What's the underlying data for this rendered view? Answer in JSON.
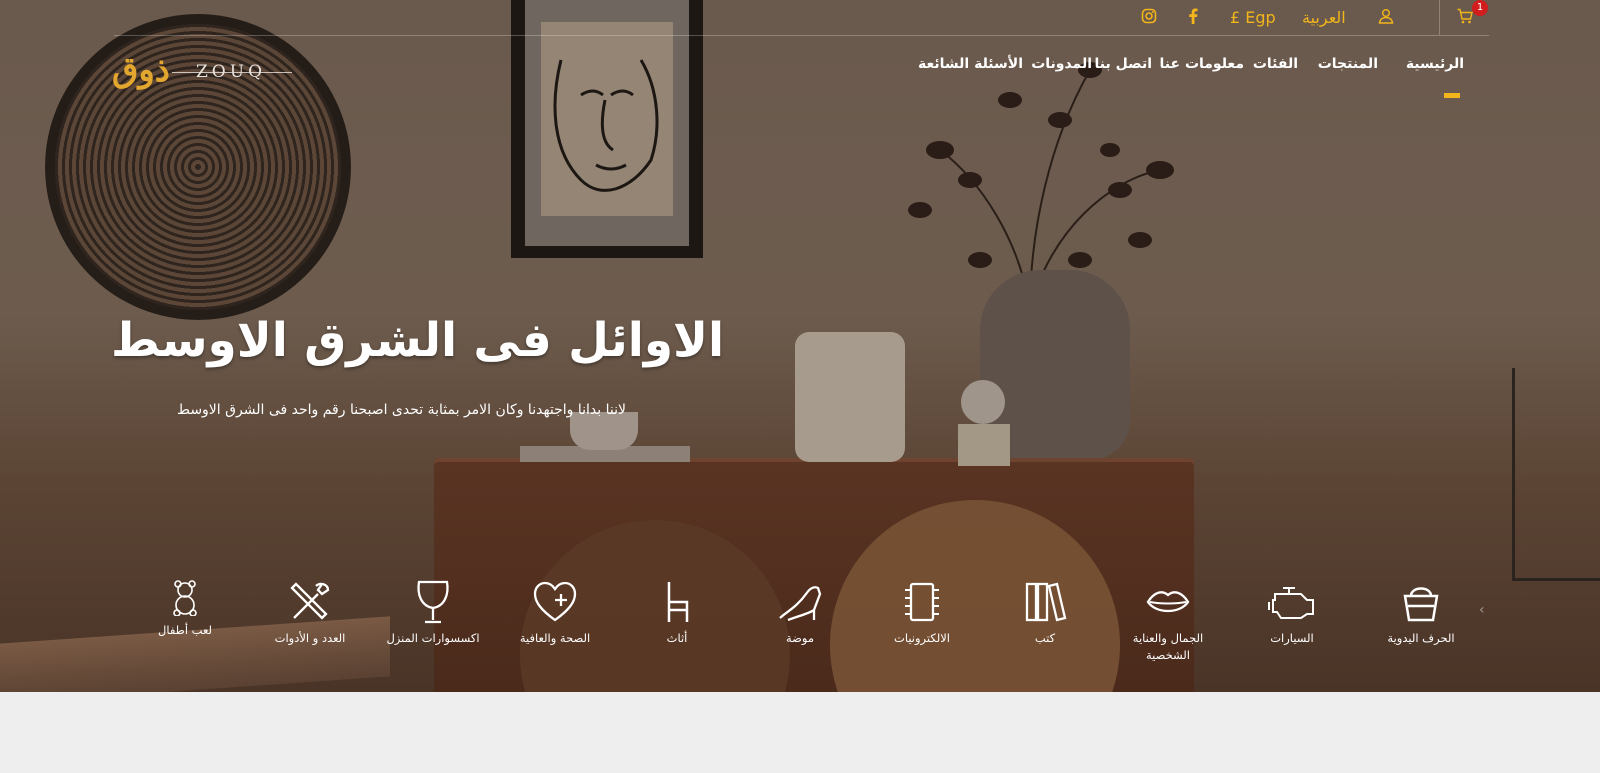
{
  "topbar": {
    "cart_count": "1",
    "language": "العربية",
    "currency": "£ Egp"
  },
  "logo": {
    "arabic": "ذوق",
    "latin": "ZOUQ"
  },
  "nav": {
    "items": [
      "الرئيسية",
      "المنتجات",
      "الفئات",
      "معلومات عنا",
      "اتصل بنا",
      "المدونات",
      "الأسئلة الشائعة"
    ],
    "active_index": 0
  },
  "hero": {
    "headline": "الاوائل فى الشرق الاوسط",
    "subline": "لاننا بدانا واجتهدنا وكان الامر بمثابة تحدى اصبحنا رقم واحد فى الشرق الاوسط"
  },
  "categories": [
    {
      "label": "الحرف اليدوية",
      "icon": "basket-icon"
    },
    {
      "label": "السيارات",
      "icon": "engine-icon"
    },
    {
      "label": "الجمال والعناية الشخصية",
      "icon": "lips-icon"
    },
    {
      "label": "كتب",
      "icon": "books-icon"
    },
    {
      "label": "الالكترونيات",
      "icon": "chip-icon"
    },
    {
      "label": "موضة",
      "icon": "heel-icon"
    },
    {
      "label": "أثاث",
      "icon": "chair-icon"
    },
    {
      "label": "الصحة والعافية",
      "icon": "heart-plus-icon"
    },
    {
      "label": "اكسسوارات المنزل",
      "icon": "glass-icon"
    },
    {
      "label": "العدد و الأدوات",
      "icon": "tools-icon"
    },
    {
      "label": "لعب أطفال",
      "icon": "teddy-icon"
    }
  ],
  "colors": {
    "accent": "#f2b51b",
    "badge": "#d11d1d",
    "footer_bg": "#eeeeee"
  }
}
